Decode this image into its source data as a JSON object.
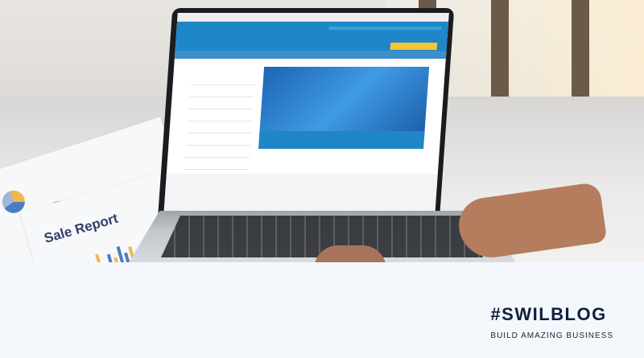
{
  "photo": {
    "paper_heading": "Sale Report",
    "colors": {
      "screen_blue": "#1f86c7",
      "cta_yellow": "#f6c634",
      "brand_dark": "#0f1f3d"
    }
  },
  "brand": {
    "title": "#SWILBLOG",
    "tagline": "BUILD AMAZING BUSINESS"
  }
}
